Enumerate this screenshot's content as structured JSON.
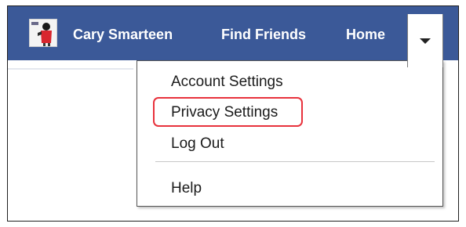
{
  "header": {
    "background_color": "#3b5998",
    "user_name": "Cary Smarteen",
    "avatar_icon": "profile-photo",
    "find_friends_label": "Find Friends",
    "home_label": "Home",
    "dropdown_icon": "caret-down-icon"
  },
  "account_menu": {
    "items": [
      {
        "label": "Account Settings"
      },
      {
        "label": "Privacy Settings",
        "highlighted": true
      },
      {
        "label": "Log Out"
      },
      {
        "label": "Help"
      }
    ],
    "highlight_color": "#e8323c"
  }
}
